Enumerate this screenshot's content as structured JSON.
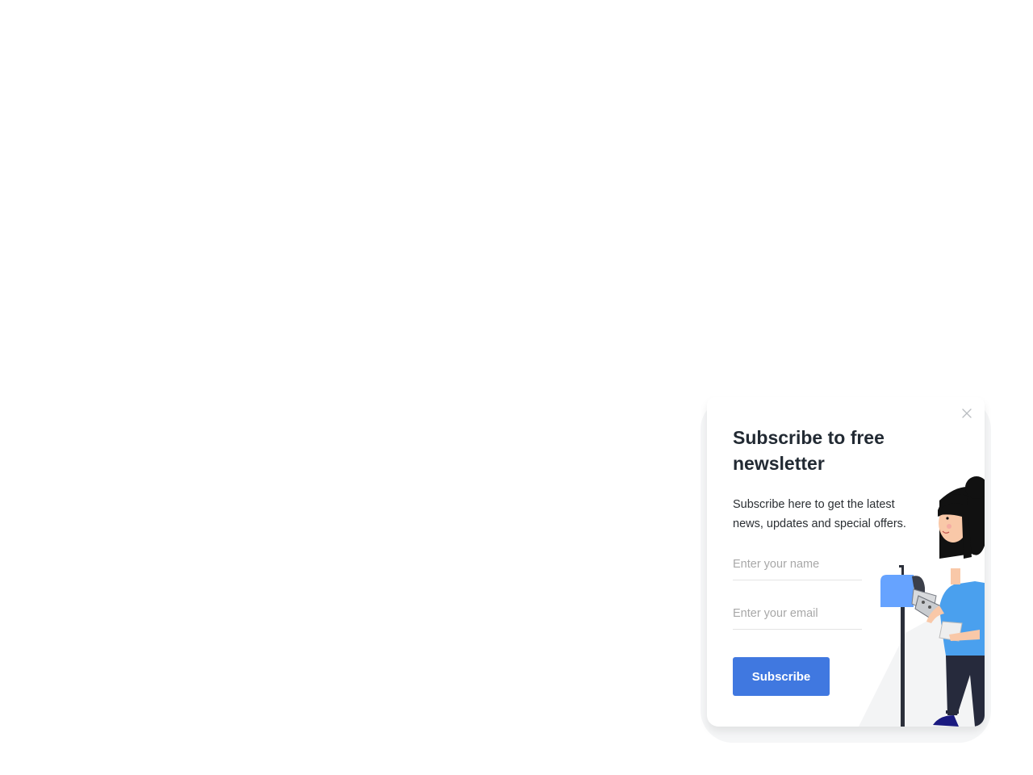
{
  "popup": {
    "title": "Subscribe to free newsletter",
    "description": "Subscribe here to get the latest news, updates and special offers.",
    "name_placeholder": "Enter your name",
    "email_placeholder": "Enter your email",
    "button_label": "Subscribe",
    "close_icon": "close-icon",
    "illustration": "woman-mailbox-illustration"
  },
  "colors": {
    "accent": "#4078e0",
    "title": "#222a33",
    "body_text": "#2b2f33",
    "placeholder": "#a8a8a8",
    "mailbox": "#66a3ff",
    "shirt": "#4aa0ee",
    "pants": "#262a3c",
    "hair": "#111111",
    "shoes": "#1a1a80"
  }
}
